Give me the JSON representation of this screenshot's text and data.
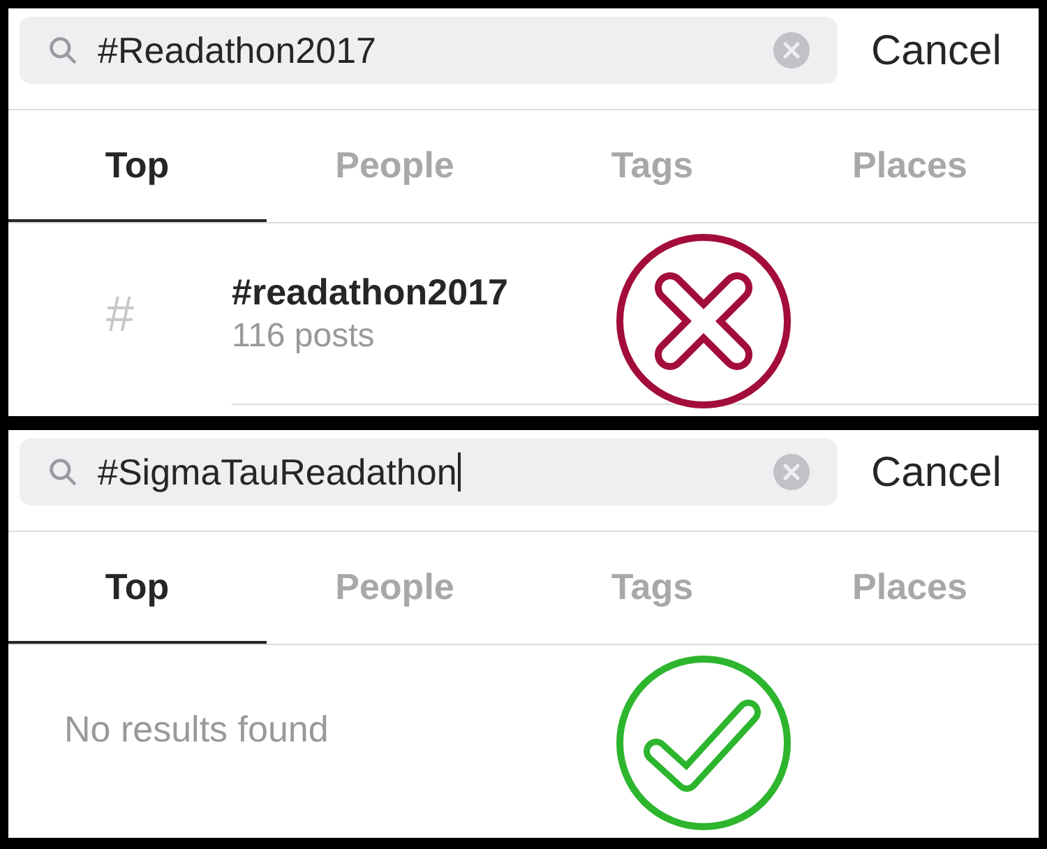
{
  "panels": [
    {
      "search": {
        "value": "#Readathon2017",
        "focused": false,
        "cancel": "Cancel"
      },
      "tabs": [
        {
          "label": "Top",
          "selected": true
        },
        {
          "label": "People",
          "selected": false
        },
        {
          "label": "Tags",
          "selected": false
        },
        {
          "label": "Places",
          "selected": false
        }
      ],
      "result": {
        "kind": "tag",
        "icon": "#",
        "title": "#readathon2017",
        "subtitle": "116 posts"
      },
      "verdict": {
        "kind": "wrong"
      }
    },
    {
      "search": {
        "value": "#SigmaTauReadathon",
        "focused": true,
        "cancel": "Cancel"
      },
      "tabs": [
        {
          "label": "Top",
          "selected": true
        },
        {
          "label": "People",
          "selected": false
        },
        {
          "label": "Tags",
          "selected": false
        },
        {
          "label": "Places",
          "selected": false
        }
      ],
      "result": {
        "kind": "empty",
        "message": "No results found"
      },
      "verdict": {
        "kind": "right"
      }
    }
  ]
}
